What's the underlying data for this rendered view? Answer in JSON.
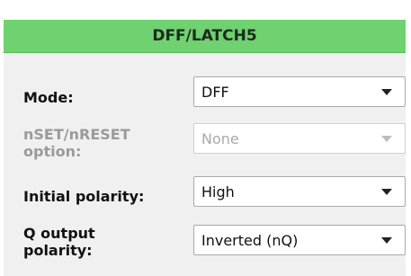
{
  "header": {
    "title": "DFF/LATCH5",
    "color": "#6fd16f"
  },
  "fields": {
    "mode": {
      "label": "Mode:",
      "value": "DFF",
      "enabled": true
    },
    "nset": {
      "label": "nSET/nRESET\noption:",
      "value": "None",
      "enabled": false
    },
    "initial": {
      "label": "Initial polarity:",
      "value": "High",
      "enabled": true
    },
    "qout": {
      "label": "Q output\npolarity:",
      "value": "Inverted (nQ)",
      "enabled": true
    }
  }
}
